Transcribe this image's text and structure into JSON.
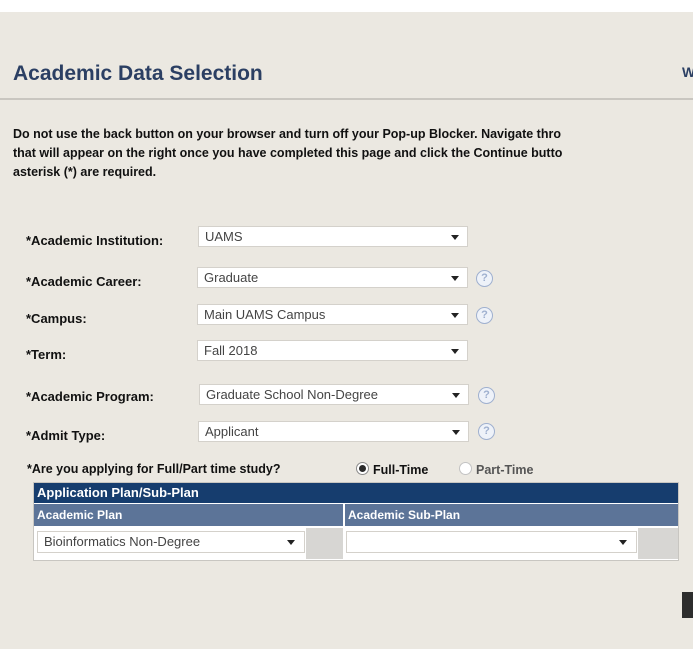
{
  "page": {
    "title": "Academic Data Selection",
    "corner_text": "W",
    "instructions": [
      "Do not use the back button on your browser and turn off your Pop-up Blocker.  Navigate thro",
      "that will appear on the right once you have completed this page and click the Continue butto",
      "asterisk (*) are required."
    ]
  },
  "fields": {
    "institution": {
      "label": "*Academic Institution:",
      "value": "UAMS"
    },
    "career": {
      "label": "*Academic Career:",
      "value": "Graduate"
    },
    "campus": {
      "label": "*Campus:",
      "value": "Main UAMS Campus"
    },
    "term": {
      "label": "*Term:",
      "value": "Fall 2018"
    },
    "program": {
      "label": "*Academic Program:",
      "value": "Graduate School Non-Degree"
    },
    "admit_type": {
      "label": "*Admit Type:",
      "value": "Applicant"
    }
  },
  "study": {
    "question": "*Are you applying for Full/Part time study?",
    "options": [
      {
        "label": "Full-Time",
        "selected": true
      },
      {
        "label": "Part-Time",
        "selected": false
      }
    ]
  },
  "plan_table": {
    "heading": "Application Plan/Sub-Plan",
    "columns": [
      "Academic Plan",
      "Academic Sub-Plan"
    ],
    "plan_value": "Bioinformatics Non-Degree",
    "subplan_value": ""
  },
  "icons": {
    "help": "help-icon",
    "dropdown": "chevron-down-icon"
  },
  "colors": {
    "title": "#2b3f63",
    "table_header": "#163d6e",
    "column_header": "#5c7498",
    "background": "#ebe8e1"
  }
}
